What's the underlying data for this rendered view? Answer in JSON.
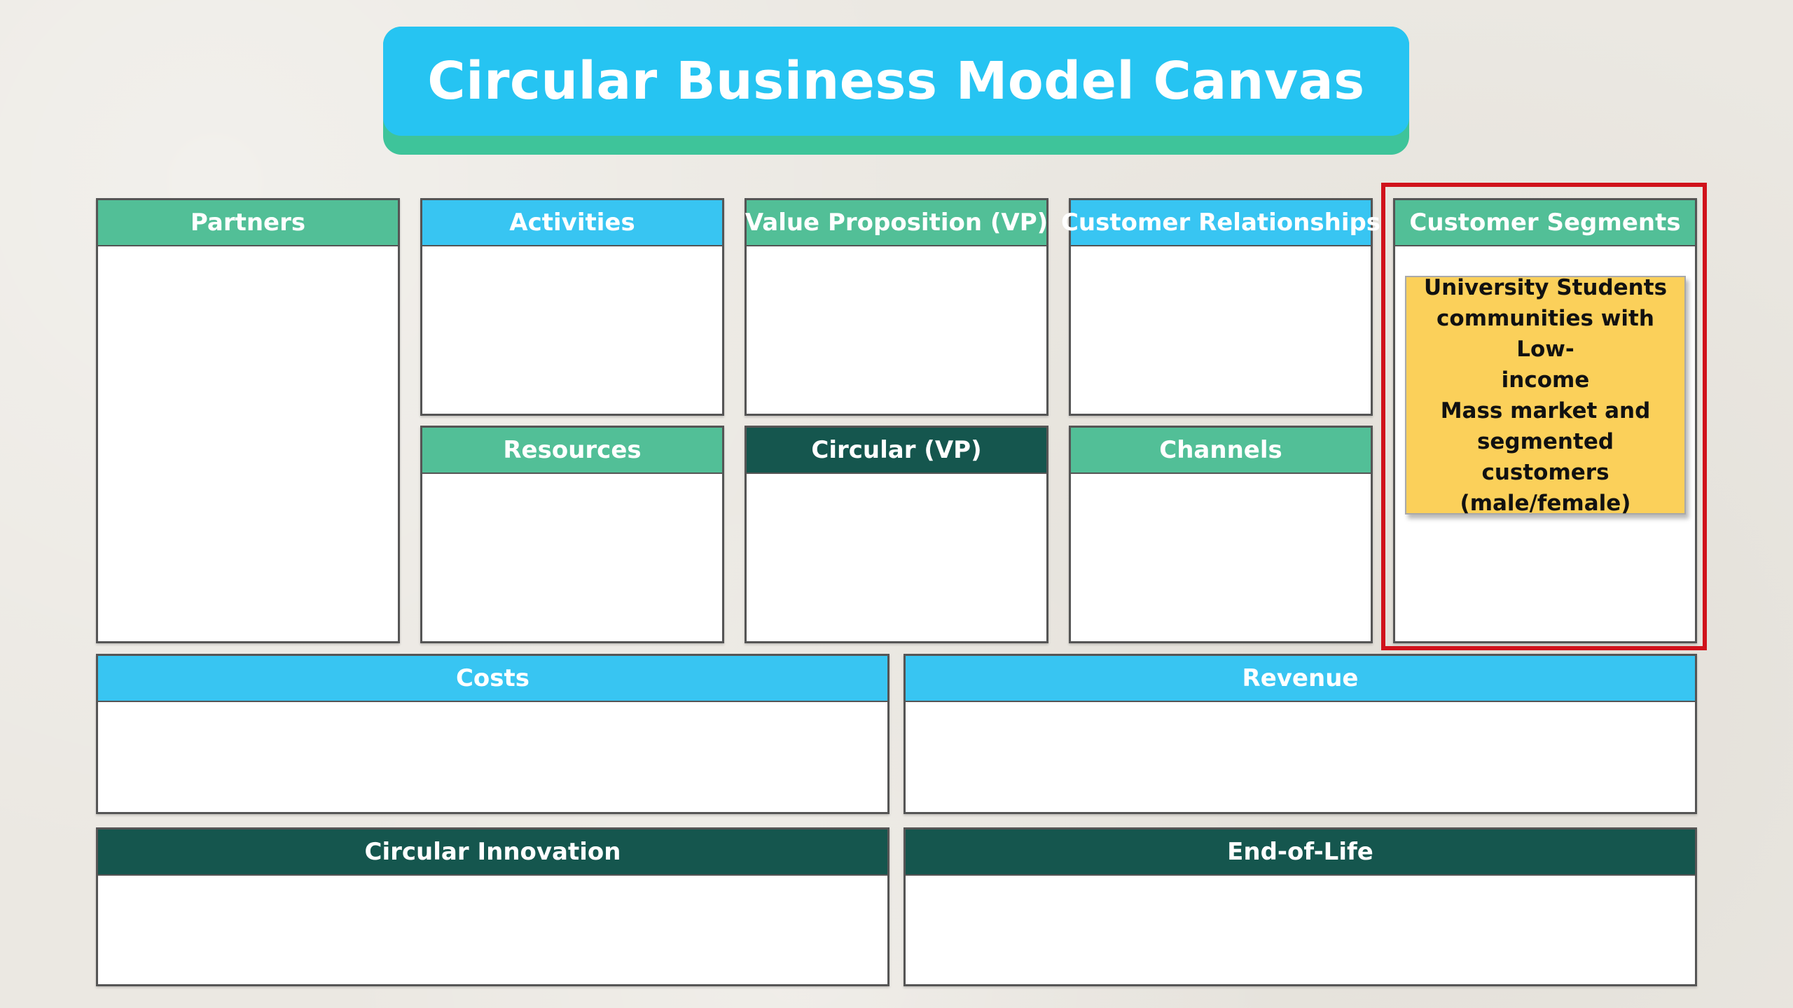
{
  "title": "Circular Business Model Canvas",
  "blocks": {
    "partners": "Partners",
    "activities": "Activities",
    "value_proposition": "Value Proposition (VP)",
    "customer_relationships": "Customer Relationships",
    "customer_segments": "Customer Segments",
    "resources": "Resources",
    "circular_vp": "Circular (VP)",
    "channels": "Channels",
    "costs": "Costs",
    "revenue": "Revenue",
    "circular_innovation": "Circular Innovation",
    "end_of_life": "End-of-Life"
  },
  "sticky_note": {
    "lines": [
      "University Students",
      "communities with Low-",
      "income",
      "Mass market and",
      "segmented customers",
      "(male/female)"
    ]
  },
  "colors": {
    "title_blue": "#26c4f2",
    "title_shadow_green": "#3ec49a",
    "header_green": "#52bf97",
    "header_blue": "#38c5f2",
    "header_dark": "#15564e",
    "sticky_yellow": "#fbd05a",
    "highlight_red": "#d0121b"
  }
}
